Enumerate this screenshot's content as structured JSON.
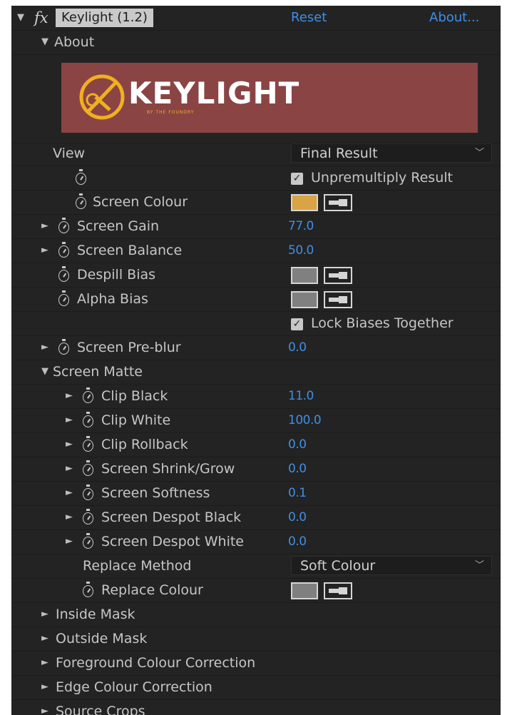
{
  "header": {
    "fx_label": "fx",
    "effect_name": "Keylight (1.2)",
    "reset_label": "Reset",
    "about_label": "About..."
  },
  "about_section": {
    "label": "About",
    "logo_text": "KEYLIGHT",
    "logo_subtext": "BY THE FOUNDRY",
    "colors": {
      "banner": "#8b4444",
      "ring": "#f0b020"
    }
  },
  "view": {
    "label": "View",
    "value": "Final Result"
  },
  "unpremultiply": {
    "label": "Unpremultiply Result",
    "checked": true
  },
  "screen_colour": {
    "label": "Screen Colour",
    "color": "#d9a444"
  },
  "screen_gain": {
    "label": "Screen Gain",
    "value": "77.0"
  },
  "screen_balance": {
    "label": "Screen Balance",
    "value": "50.0"
  },
  "despill_bias": {
    "label": "Despill Bias",
    "color": "#808080"
  },
  "alpha_bias": {
    "label": "Alpha Bias",
    "color": "#808080"
  },
  "lock_biases": {
    "label": "Lock Biases Together",
    "checked": true
  },
  "screen_preblur": {
    "label": "Screen Pre-blur",
    "value": "0.0"
  },
  "screen_matte": {
    "label": "Screen Matte",
    "clip_black": {
      "label": "Clip Black",
      "value": "11.0"
    },
    "clip_white": {
      "label": "Clip White",
      "value": "100.0"
    },
    "clip_rollback": {
      "label": "Clip Rollback",
      "value": "0.0"
    },
    "shrink_grow": {
      "label": "Screen Shrink/Grow",
      "value": "0.0"
    },
    "softness": {
      "label": "Screen Softness",
      "value": "0.1"
    },
    "despot_black": {
      "label": "Screen Despot Black",
      "value": "0.0"
    },
    "despot_white": {
      "label": "Screen Despot White",
      "value": "0.0"
    },
    "replace_method": {
      "label": "Replace Method",
      "value": "Soft Colour"
    },
    "replace_colour": {
      "label": "Replace Colour",
      "color": "#808080"
    }
  },
  "collapsed_sections": [
    "Inside Mask",
    "Outside Mask",
    "Foreground Colour Correction",
    "Edge Colour Correction",
    "Source Crops"
  ],
  "colors": {
    "panel_bg": "#232323",
    "value_blue": "#3f8fe6",
    "text": "#c6c6c6"
  }
}
